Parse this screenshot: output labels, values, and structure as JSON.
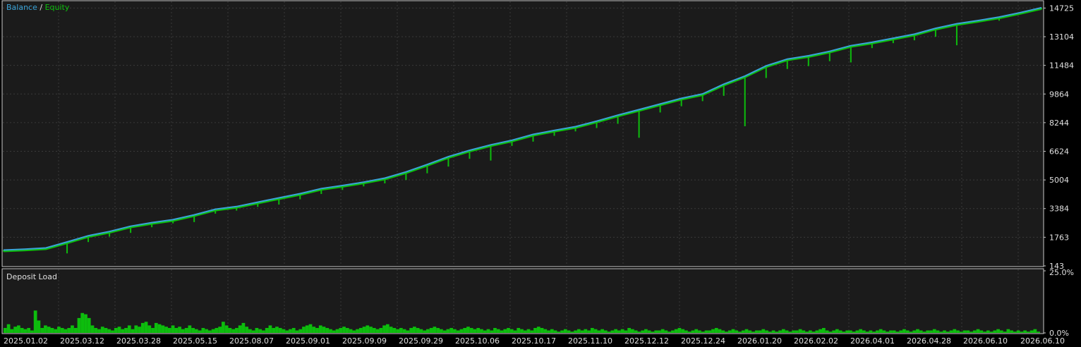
{
  "legend": {
    "balance_label": "Balance",
    "separator": " / ",
    "equity_label": "Equity"
  },
  "colors": {
    "background": "#1b1b1b",
    "frame": "#c8c8c8",
    "grid": "#3a3a3a",
    "text": "#e0e0e0",
    "balance": "#3aa3d8",
    "equity": "#0dbd0d",
    "deposit_load": "#0dbd0d"
  },
  "chart_data": [
    {
      "type": "line",
      "title": "",
      "legend_placement": "top-left",
      "grid": true,
      "x_dates": [
        "2025.01.02",
        "2025.03.12",
        "2025.03.28",
        "2025.05.15",
        "2025.08.07",
        "2025.09.01",
        "2025.09.09",
        "2025.09.29",
        "2025.10.06",
        "2025.10.17",
        "2025.11.10",
        "2025.12.12",
        "2025.12.24",
        "2026.01.20",
        "2026.02.02",
        "2026.04.01",
        "2026.04.28",
        "2026.06.10",
        "2026.06.10"
      ],
      "ylim": [
        143,
        15100
      ],
      "yticks": [
        "14725",
        "13104",
        "11484",
        "9864",
        "8244",
        "6624",
        "5004",
        "3384",
        "1763",
        "143"
      ],
      "series": [
        {
          "name": "Balance",
          "values": [
            1040,
            1090,
            1160,
            1500,
            1850,
            2090,
            2390,
            2590,
            2760,
            3030,
            3350,
            3500,
            3750,
            3990,
            4230,
            4520,
            4690,
            4880,
            5110,
            5460,
            5880,
            6320,
            6680,
            6990,
            7250,
            7580,
            7810,
            8020,
            8330,
            8670,
            8980,
            9300,
            9620,
            9870,
            10420,
            10880,
            11460,
            11840,
            12030,
            12280,
            12600,
            12790,
            13020,
            13250,
            13580,
            13840,
            14020,
            14220,
            14470,
            14745
          ]
        },
        {
          "name": "Equity",
          "values": [
            1000,
            1000,
            1090,
            850,
            1490,
            1800,
            2010,
            2330,
            2550,
            2620,
            3100,
            3270,
            3480,
            3610,
            3910,
            4210,
            4440,
            4640,
            4810,
            5000,
            5380,
            5760,
            6200,
            6100,
            6930,
            7170,
            7500,
            7750,
            7940,
            8180,
            7390,
            8820,
            9170,
            9460,
            9760,
            8040,
            10770,
            11280,
            11440,
            11720,
            11650,
            12460,
            12740,
            12900,
            13100,
            12620,
            14110,
            14010,
            14460,
            14745
          ]
        }
      ]
    },
    {
      "type": "bar",
      "title": "Deposit Load",
      "ylim": [
        0,
        25
      ],
      "yticks": [
        "25.0%",
        "0.0%"
      ],
      "grid": true,
      "values": [
        2,
        3.5,
        1.5,
        2.5,
        3,
        2,
        1.5,
        2,
        1,
        9,
        5,
        2,
        3,
        2.5,
        2,
        1.5,
        2.5,
        2,
        1.5,
        2,
        3,
        2,
        6,
        8,
        7.5,
        6,
        3,
        2,
        1.5,
        2.5,
        2,
        1.5,
        1,
        2,
        2.5,
        1.5,
        2,
        3,
        1.5,
        3,
        2.5,
        4,
        4.5,
        3,
        2,
        4,
        3.5,
        3,
        2.5,
        2,
        3,
        2,
        2.5,
        1.5,
        2,
        3,
        2,
        1.5,
        1,
        2,
        1.5,
        1,
        1.5,
        2,
        2.5,
        4.5,
        3,
        2,
        1.5,
        2,
        3,
        4,
        2.5,
        1.5,
        1,
        2,
        1.5,
        1,
        2,
        3,
        2,
        2.5,
        2,
        1.5,
        1,
        1.5,
        2,
        1,
        1.5,
        2.5,
        3,
        3.5,
        2.5,
        2,
        3,
        2.5,
        2,
        1.5,
        1,
        1.5,
        2,
        2.5,
        2,
        1.5,
        1,
        1.5,
        2,
        2.5,
        3,
        2.5,
        2,
        1.5,
        2,
        3,
        3.5,
        2.5,
        2,
        1.5,
        2,
        1.5,
        1,
        2,
        2.5,
        2,
        1.5,
        1,
        1.5,
        2,
        2.5,
        2,
        1.5,
        1,
        1.5,
        2,
        1.5,
        1,
        1.5,
        2,
        2.5,
        2,
        1.5,
        2,
        1.5,
        1,
        1.5,
        1,
        2,
        1.5,
        1,
        1.5,
        2,
        1.5,
        1,
        2,
        1.5,
        1,
        1.5,
        1,
        2,
        2.5,
        2,
        1.5,
        1,
        1.5,
        1,
        0.5,
        1,
        1.5,
        1,
        0.5,
        1,
        1.5,
        1,
        1.5,
        1,
        2,
        1.5,
        1,
        1.5,
        1,
        0.5,
        1,
        1.5,
        1,
        1.5,
        1,
        2,
        1.5,
        1,
        0.5,
        1,
        1.5,
        1,
        0.5,
        1,
        1,
        1.5,
        1,
        0.5,
        1,
        1.5,
        2,
        1.5,
        1,
        0.5,
        1,
        1.5,
        1,
        0.5,
        1,
        1,
        1.5,
        2,
        1.5,
        1,
        0.5,
        1,
        1.5,
        1,
        0.5,
        1,
        1.5,
        1,
        0.5,
        1,
        1,
        1.5,
        1,
        0.5,
        1,
        0.5,
        1,
        1.5,
        1,
        0.5,
        1,
        1,
        1.5,
        1,
        0.5,
        1,
        0.5,
        1,
        1.5,
        2,
        1,
        0.5,
        1,
        1.5,
        1,
        0.5,
        1,
        1,
        0.5,
        1,
        1.5,
        1,
        0.5,
        1,
        0.5,
        1,
        1.5,
        1,
        0.5,
        1,
        1,
        0.5,
        1,
        1.5,
        1,
        0.5,
        1,
        1.5,
        1,
        0.5,
        1,
        1,
        1.5,
        1,
        0.5,
        1,
        0.5,
        1,
        1.5,
        1,
        0.5,
        1,
        1,
        0.5,
        1,
        1.5,
        1,
        0.5,
        1,
        0.5,
        1,
        1.5,
        1,
        0.5,
        1.5,
        1,
        0.5,
        1,
        0.5,
        1,
        0.5,
        1,
        1.5,
        0.5
      ]
    }
  ]
}
